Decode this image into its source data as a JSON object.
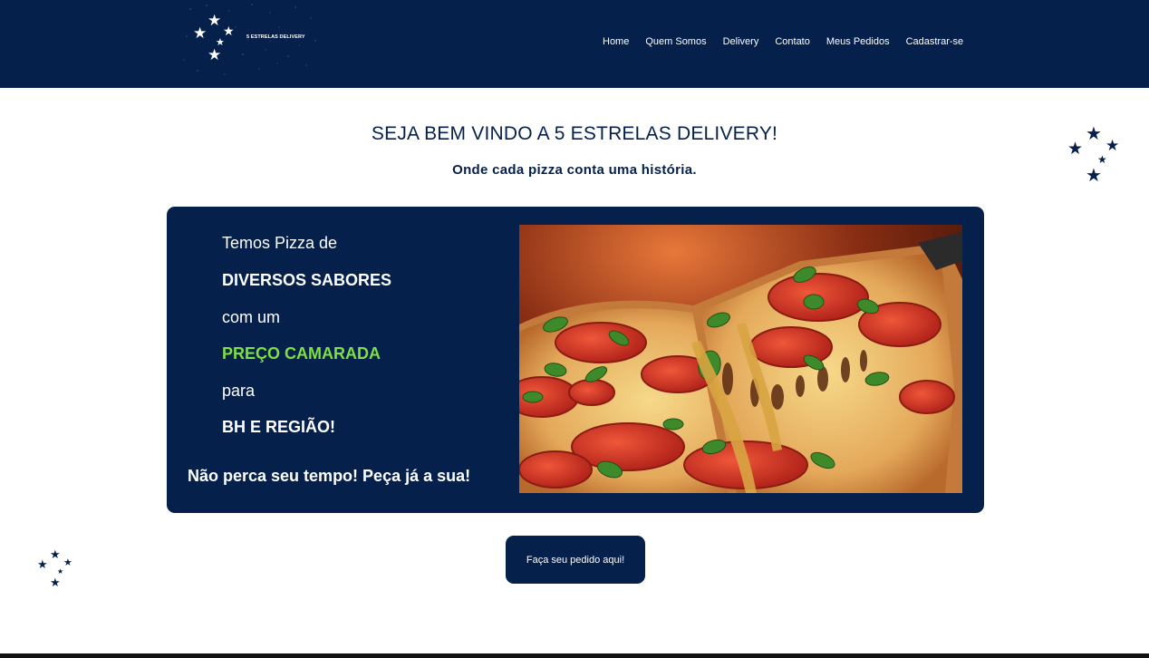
{
  "header": {
    "logo_text": "5 ESTRELAS DELIVERY",
    "nav": [
      "Home",
      "Quem Somos",
      "Delivery",
      "Contato",
      "Meus Pedidos",
      "Cadastrar-se"
    ]
  },
  "hero": {
    "title": "SEJA BEM VINDO A 5 ESTRELAS DELIVERY!",
    "subtitle": "Onde cada pizza conta uma história."
  },
  "promo": {
    "lines": [
      "Temos Pizza de",
      "DIVERSOS SABORES",
      "com um",
      "PREÇO CAMARADA",
      "para",
      "BH E REGIÃO!"
    ],
    "cta": "Não perca seu tempo! Peça já a sua!"
  },
  "order_button": "Faça seu pedido aqui!",
  "colors": {
    "navy": "#04204b",
    "accent_green": "#7ee043",
    "white": "#ffffff"
  },
  "icons": [
    "logo-stars-icon",
    "stars-decoration-icon"
  ]
}
